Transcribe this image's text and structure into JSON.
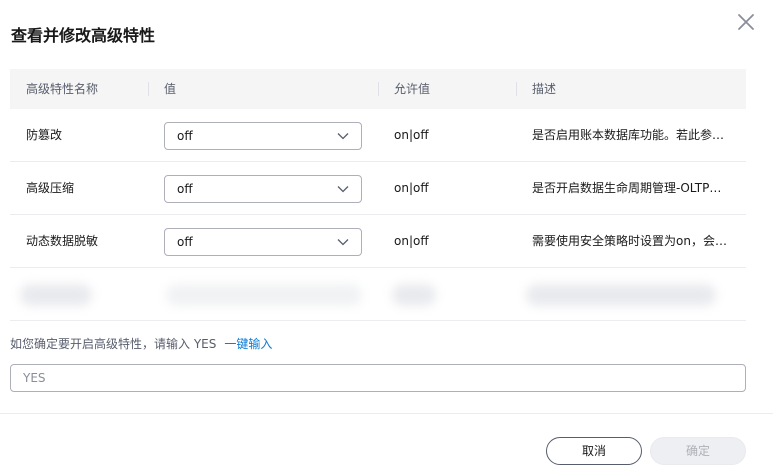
{
  "dialog": {
    "title": "查看并修改高级特性"
  },
  "table": {
    "headers": [
      "高级特性名称",
      "值",
      "允许值",
      "描述"
    ],
    "rows": [
      {
        "name": "防篡改",
        "value": "off",
        "allowed": "on|off",
        "description": "是否启用账本数据库功能。若此参…"
      },
      {
        "name": "高级压缩",
        "value": "off",
        "allowed": "on|off",
        "description": "是否开启数据生命周期管理-OLTP…"
      },
      {
        "name": "动态数据脱敏",
        "value": "off",
        "allowed": "on|off",
        "description": "需要使用安全策略时设置为on，会…"
      }
    ]
  },
  "confirm": {
    "label": "如您确定要开启高级特性，请输入 YES",
    "quick_link": "一键输入",
    "placeholder": "YES"
  },
  "footer": {
    "cancel_label": "取消",
    "ok_label": "确定"
  }
}
